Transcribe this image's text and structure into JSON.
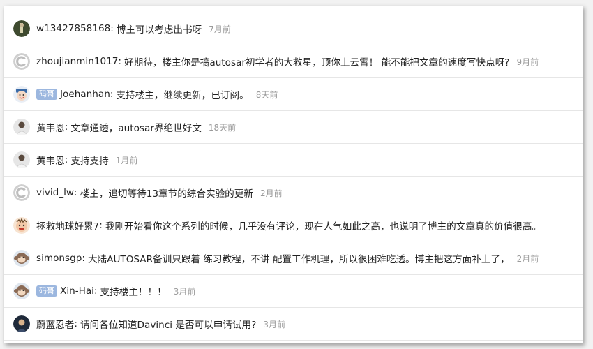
{
  "comments": [
    {
      "user": "w13427858168",
      "sep": ":",
      "text": "博主可以考虑出书呀",
      "time": "7月前",
      "badge": ""
    },
    {
      "user": "zhoujianmin1017",
      "sep": ":",
      "text": "好期待，楼主你是搞autosar初学者的大救星，顶你上云霄！ 能不能把文章的速度写快点呀?",
      "time": "9月前",
      "badge": ""
    },
    {
      "user": "Joehanhan",
      "sep": ":",
      "text": "支持楼主，继续更新，已订阅。",
      "time": "8天前",
      "badge": "码哥"
    },
    {
      "user": "黄韦恩",
      "sep": ":",
      "text": "文章通透，autosar界绝世好文",
      "time": "18天前",
      "badge": ""
    },
    {
      "user": "黄韦恩",
      "sep": ":",
      "text": "支持支持",
      "time": "1月前",
      "badge": ""
    },
    {
      "user": "vivid_lw",
      "sep": ":",
      "text": "楼主，追切等待13章节的综合实验的更新",
      "time": "2月前",
      "badge": ""
    },
    {
      "user": "拯救地球好累7",
      "sep": ":",
      "text": "我刚开始看你这个系列的时候，几乎没有评论，现在人气如此之高，也说明了博主的文章真的价值很高。",
      "time": "",
      "badge": ""
    },
    {
      "user": "simonsgp",
      "sep": ":",
      "text": "大陆AUTOSAR备训只跟着 练习教程，不讲 配置工作机理，所以很困难吃透。博主把这方面补上了，",
      "time": "2月前",
      "badge": ""
    },
    {
      "user": "Xin-Hai",
      "sep": ":",
      "text": "支持楼主！！！",
      "time": "3月前",
      "badge": "码哥"
    },
    {
      "user": "蔚蓝忍者",
      "sep": ":",
      "text": "请问各位知道Davinci 是否可以申请试用?",
      "time": "3月前",
      "badge": ""
    }
  ],
  "colors": {
    "badge": "#9cb7df",
    "time": "#9a9a9a",
    "text": "#222222"
  },
  "avatar_icons": [
    "photo-avatar",
    "c-logo-avatar",
    "emoji-avatar",
    "photo-avatar",
    "photo-avatar",
    "c-logo-avatar",
    "cartoon-avatar",
    "monkey-avatar",
    "monkey-avatar",
    "photo-avatar"
  ]
}
